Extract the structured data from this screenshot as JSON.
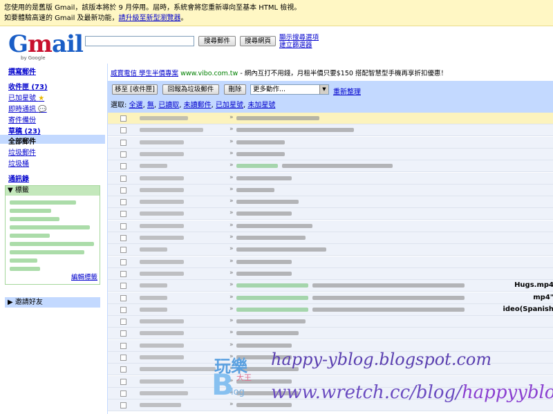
{
  "banner": {
    "line1": "您使用的是舊版 Gmail，該版本將於 9 月停用。屆時，系統會將您重新導向至基本 HTML 檢視。",
    "line2_prefix": "如要體驗高速的 Gmail 及最新功能，",
    "line2_link": "請升級至新型瀏覽器",
    "line2_suffix": "。"
  },
  "logo": {
    "text": "Gmail",
    "by": "by Google"
  },
  "search": {
    "value": "",
    "search_mail_label": "搜尋郵件",
    "search_web_label": "搜尋網頁",
    "show_options_label": "顯示搜尋選項",
    "create_filter_label": "建立篩選器"
  },
  "nav": {
    "compose": "撰寫郵件",
    "inbox": "收件匣 (73)",
    "starred": "已加星號",
    "chats": "即時通訊",
    "sent": "寄件備份",
    "drafts": "草稿 (23)",
    "all_mail": "全部郵件",
    "spam": "垃圾郵件",
    "trash": "垃圾桶",
    "contacts": "通訊錄"
  },
  "labels": {
    "header": "▼ 標籤",
    "edit": "編輯標籤"
  },
  "invite": {
    "header": "▶ 邀請好友"
  },
  "ad": {
    "title": "威寶電信 學生半價專案",
    "url": "www.vibo.com.tw",
    "text": "- 網內互打不用錢，月租半價只要$150 搭配智慧型手機再享折扣優惠！"
  },
  "toolbar": {
    "archive_label": "移至 [收件匣]",
    "report_spam_label": "回報為垃圾郵件",
    "delete_label": "刪除",
    "more_actions": "更多動作...",
    "refresh": "重新整理",
    "select_prefix": "選取:",
    "select_all": "全選",
    "select_none": "無",
    "select_read": "已讀取",
    "select_unread": "未讀郵件",
    "select_starred": "已加星號",
    "select_unstarred": "未加星號"
  },
  "rows": [
    {
      "highlight": true,
      "bold": ""
    },
    {
      "highlight": false,
      "bold": ""
    },
    {
      "highlight": false,
      "bold": ""
    },
    {
      "highlight": false,
      "bold": ""
    },
    {
      "highlight": false,
      "bold": ""
    },
    {
      "highlight": false,
      "bold": ""
    },
    {
      "highlight": false,
      "bold": ""
    },
    {
      "highlight": false,
      "bold": ""
    },
    {
      "highlight": false,
      "bold": ""
    },
    {
      "highlight": false,
      "bold": ""
    },
    {
      "highlight": false,
      "bold": ""
    },
    {
      "highlight": false,
      "bold": ""
    },
    {
      "highlight": false,
      "bold": ""
    },
    {
      "highlight": false,
      "bold": ""
    },
    {
      "highlight": false,
      "bold": "Hugs.mp4"
    },
    {
      "highlight": false,
      "bold": "mp4\""
    },
    {
      "highlight": false,
      "bold": "ideo(Spanish"
    },
    {
      "highlight": false,
      "bold": ""
    },
    {
      "highlight": false,
      "bold": ""
    },
    {
      "highlight": false,
      "bold": ""
    },
    {
      "highlight": false,
      "bold": ""
    },
    {
      "highlight": false,
      "bold": ""
    },
    {
      "highlight": false,
      "bold": ""
    },
    {
      "highlight": false,
      "bold": ""
    },
    {
      "highlight": false,
      "bold": ""
    }
  ],
  "watermark": {
    "logo_text": "玩樂",
    "logo_sub": "大王",
    "logo_letter": "B",
    "logo_small": "log",
    "line1": "happy-yblog.blogspot.com",
    "line2_prefix": "www.wretch.cc/blog/",
    "line2_suffix": "happyyblog"
  },
  "colors": {
    "banner_bg": "#fff7c4",
    "nav_blue": "#c3d9ff",
    "labels_green": "#c4e8bc",
    "highlight_row": "#fcf3bd"
  }
}
